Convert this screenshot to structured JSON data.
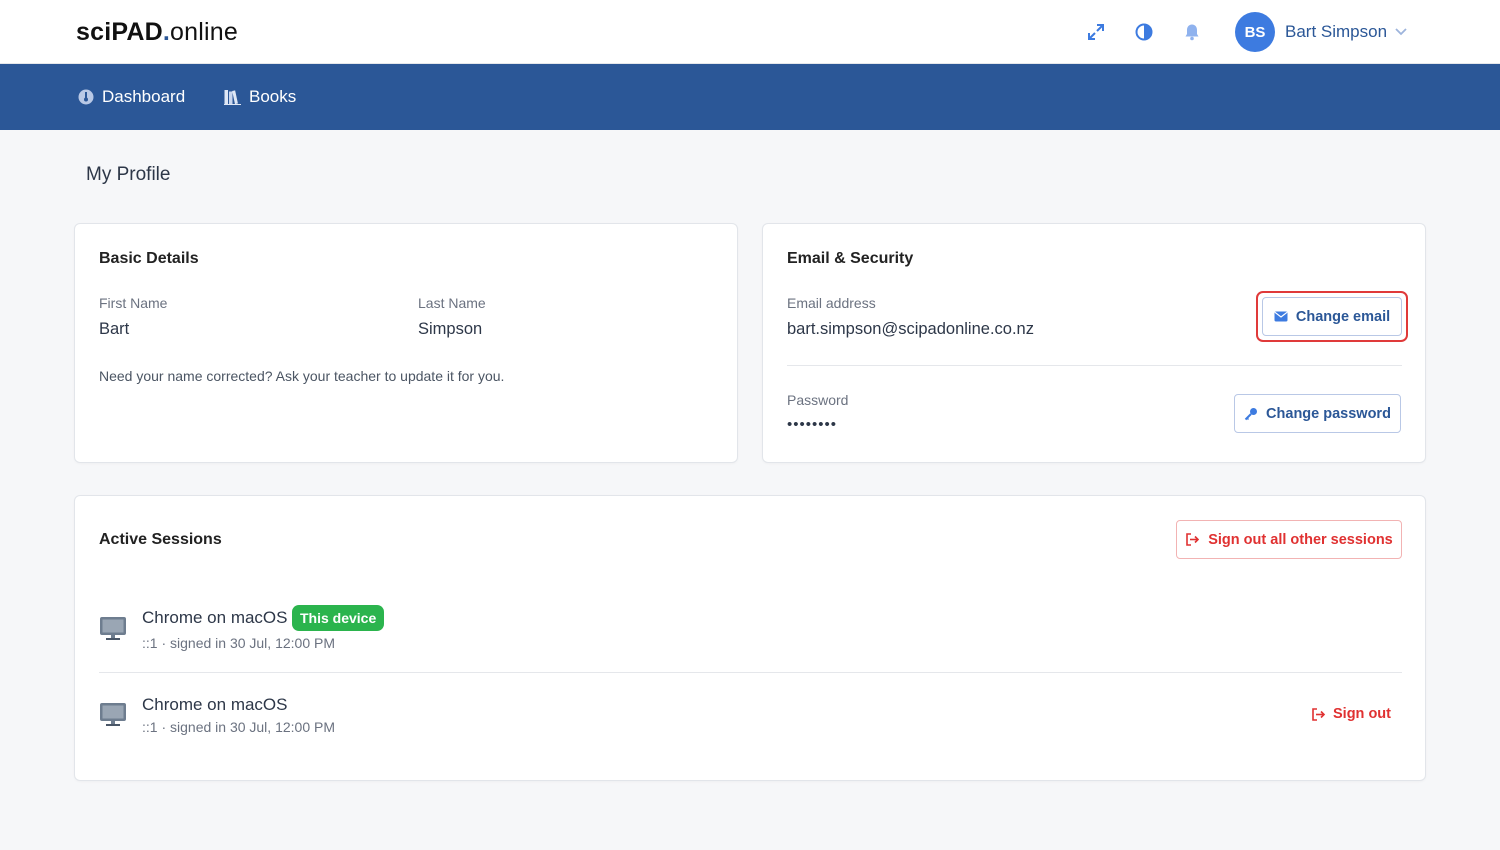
{
  "header": {
    "logo_bold": "sciPAD",
    "logo_dot": ".",
    "logo_light": "online",
    "icons": [
      "expand-icon",
      "contrast-icon",
      "bell-icon",
      "chevron-down-icon"
    ],
    "user": {
      "initials": "BS",
      "name": "Bart Simpson"
    }
  },
  "nav": {
    "items": [
      {
        "label": "Dashboard",
        "icon": "dashboard-icon"
      },
      {
        "label": "Books",
        "icon": "books-icon"
      }
    ]
  },
  "page": {
    "title": "My Profile"
  },
  "basic_details": {
    "title": "Basic Details",
    "first_name_label": "First Name",
    "first_name": "Bart",
    "last_name_label": "Last Name",
    "last_name": "Simpson",
    "hint": "Need your name corrected? Ask your teacher to update it for you."
  },
  "email_security": {
    "title": "Email & Security",
    "email_label": "Email address",
    "email": "bart.simpson@scipadonline.co.nz",
    "change_email": "Change email",
    "password_label": "Password",
    "password": "••••••••",
    "change_password": "Change password"
  },
  "sessions": {
    "title": "Active Sessions",
    "sign_out_all": "Sign out all other sessions",
    "items": [
      {
        "name": "Chrome on macOS",
        "meta": "::1 · signed in 30 Jul, 12:00 PM",
        "badge": "This device"
      },
      {
        "name": "Chrome on macOS",
        "meta": "::1 · signed in 30 Jul, 12:00 PM",
        "action": "Sign out"
      }
    ]
  },
  "colors": {
    "primary": "#2b5797",
    "accent": "#3d7be0",
    "danger": "#e03131",
    "success": "#2bb44d",
    "highlight": "#e03a3a"
  }
}
